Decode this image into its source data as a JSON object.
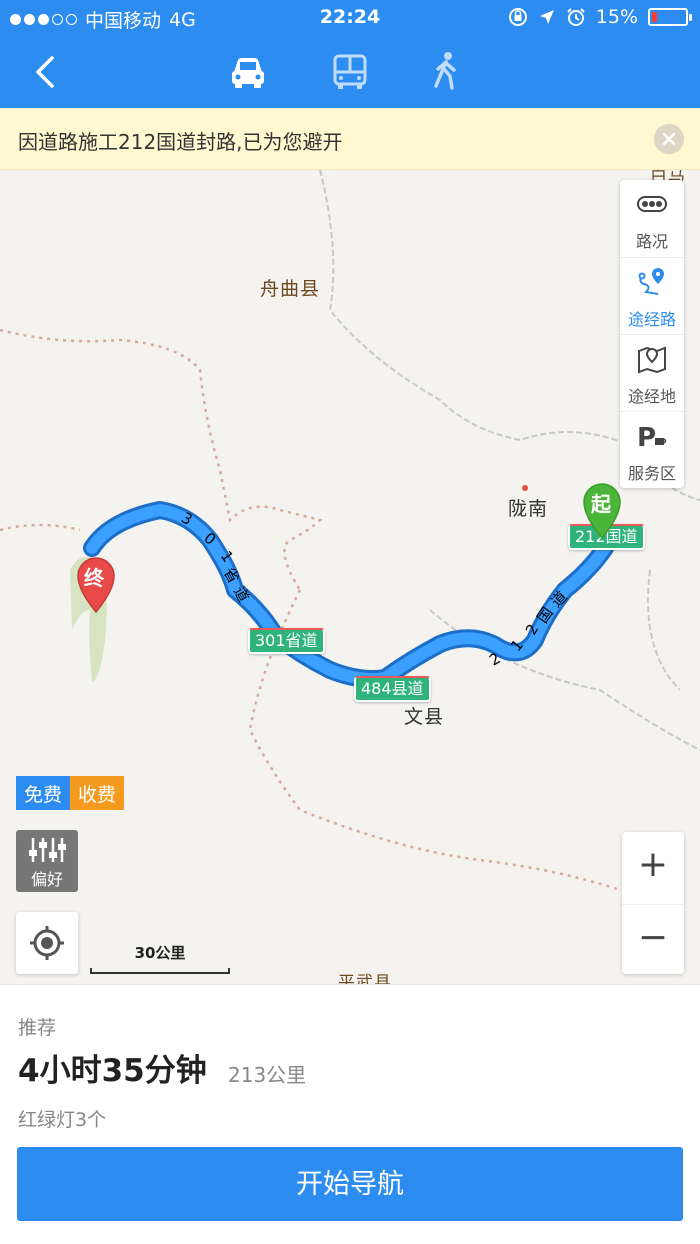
{
  "status_bar": {
    "carrier": "中国移动",
    "network": "4G",
    "time": "22:24",
    "battery": "15%",
    "battery_level": 0.15
  },
  "nav": {
    "modes": [
      "car-icon",
      "bus-icon",
      "walk-icon"
    ],
    "active_mode": "car"
  },
  "notice": {
    "text": "因道路施工212国道封路,已为您避开"
  },
  "map": {
    "places": {
      "zhouqu": "舟曲县",
      "longnan": "陇南",
      "wenxian": "文县",
      "pingwu": "平武县",
      "baima": "白马"
    },
    "roads": {
      "s301_shield": "301省道",
      "g212_shield": "212国道",
      "x484_shield": "484县道",
      "s301_along": [
        "3",
        "0",
        "1",
        "省",
        "道"
      ],
      "g212_along": [
        "2",
        "1",
        "2",
        "国",
        "道"
      ]
    },
    "markers": {
      "start": "起",
      "end": "终"
    },
    "side_panel": {
      "traffic": "路况",
      "waypoint_route": "途经路",
      "waypoint_place": "途经地",
      "service_area": "服务区"
    },
    "toll": {
      "free": "免费",
      "paid": "收费"
    },
    "preference": "偏好",
    "scale": "30公里",
    "zoom": {
      "in": "+",
      "out": "−"
    }
  },
  "route": {
    "tag": "推荐",
    "duration": "4小时35分钟",
    "distance": "213公里",
    "traffic_lights": "红绿灯3个",
    "start_button": "开始导航"
  },
  "colors": {
    "brand": "#2d8cf0",
    "route": "#2d8cf0",
    "shield": "#2fb37a",
    "paid": "#f39a1f",
    "end_marker": "#e84a4a",
    "start_marker": "#4bb53a"
  }
}
